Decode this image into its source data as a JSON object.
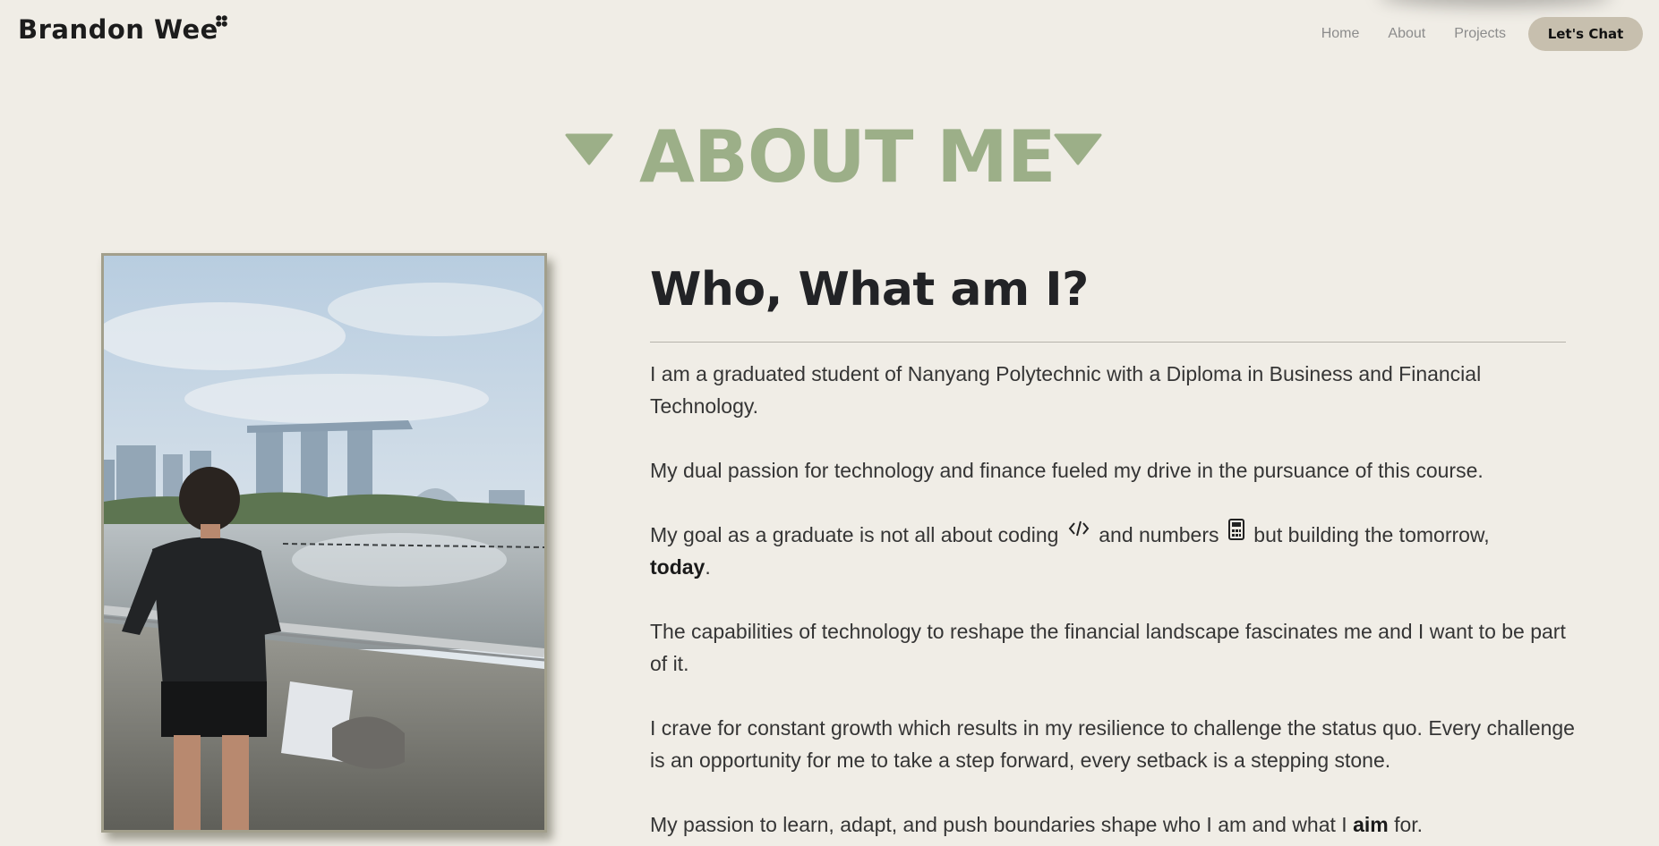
{
  "brand": {
    "name": "Brandon Wee"
  },
  "nav": {
    "links": [
      "Home",
      "About",
      "Projects"
    ],
    "cta_label": "Let's Chat"
  },
  "section": {
    "title": "ABOUT ME"
  },
  "content": {
    "heading": "Who, What am I?",
    "p1": "I am a graduated student of Nanyang Polytechnic with a Diploma in Business and Financial Technology.",
    "p2": "My dual passion for technology and finance fueled my drive in the pursuance of this course.",
    "p3": {
      "a": "My goal as a graduate is not all about coding",
      "b": "and numbers",
      "c": "but building the tomorrow,",
      "bold": "today",
      "d": "."
    },
    "p4": "The capabilities of technology to reshape the financial landscape fascinates me and I want to be part of it.",
    "p5": "I crave for constant growth which results in my resilience to challenge the status quo. Every challenge is an opportunity for me to take a step forward, every setback is a stepping stone.",
    "p6": {
      "a": "My passion to learn, adapt, and push boundaries shape who I am and what I",
      "bold": "aim",
      "b": "for."
    }
  },
  "icons": {
    "brand_mark": "four-petal-mark-icon",
    "title_decor": "triangle-down-icon",
    "coding": "code-icon",
    "numbers": "calculator-icon"
  },
  "colors": {
    "background": "#f0ede6",
    "accent_green": "#9caf88",
    "button_bg": "#c7bfae",
    "text_dark": "#222326"
  }
}
